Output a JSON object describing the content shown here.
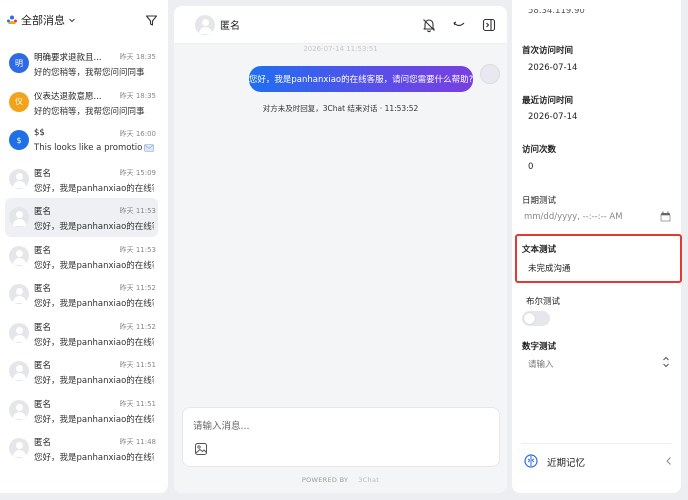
{
  "sidebar": {
    "filter_label": "全部消息",
    "conversations": [
      {
        "name": "明确要求退款且...",
        "time": "昨天 18:35",
        "preview": "好的您稍等，我帮您问问同事",
        "avatar_text": "明",
        "avatar_color": "#2d6ae3"
      },
      {
        "name": "仪表达退款意愿...",
        "time": "昨天 18:35",
        "preview": "好的您稍等，我帮您问问同事",
        "avatar_text": "仪",
        "avatar_color": "#f2a21b"
      },
      {
        "name": "$$",
        "time": "昨天 16:00",
        "preview": "This looks like a promotiona...",
        "avatar_text": "$",
        "avatar_color": "#1f6fe5"
      },
      {
        "name": "匿名",
        "time": "昨天 15:09",
        "preview": "您好，我是panhanxiao的在线客..."
      },
      {
        "name": "匿名",
        "time": "昨天 11:53",
        "preview": "您好，我是panhanxiao的在线客..."
      },
      {
        "name": "匿名",
        "time": "昨天 11:53",
        "preview": "您好，我是panhanxiao的在线客..."
      },
      {
        "name": "匿名",
        "time": "昨天 11:52",
        "preview": "您好，我是panhanxiao的在线客..."
      },
      {
        "name": "匿名",
        "time": "昨天 11:52",
        "preview": "您好，我是panhanxiao的在线客..."
      },
      {
        "name": "匿名",
        "time": "昨天 11:51",
        "preview": "您好，我是panhanxiao的在线客..."
      },
      {
        "name": "匿名",
        "time": "昨天 11:51",
        "preview": "您好，我是panhanxiao的在线客..."
      },
      {
        "name": "匿名",
        "time": "昨天 11:48",
        "preview": "您好，我是panhanxiao的在线客..."
      }
    ]
  },
  "chat": {
    "contact_name": "匿名",
    "timestamp_faded": "2026-07-14 11:53:51",
    "message": "您好，我是panhanxiao的在线客服，请问您需要什么帮助?",
    "system_note": "对方未及时回复，3Chat 结束对话 · 11:53:52",
    "input_placeholder": "请输入消息...",
    "powered_by": "POWERED BY",
    "powered_brand": "3Chat"
  },
  "details": {
    "ip_partial": "58.34.119.90",
    "first_visit_label": "首次访问时间",
    "first_visit_value": "2026-07-14",
    "last_visit_label": "最近访问时间",
    "last_visit_value": "2026-07-14",
    "visit_count_label": "访问次数",
    "visit_count_value": "0",
    "date_test_label": "日期测试",
    "date_test_placeholder": "mm/dd/yyyy, --:--:-- AM",
    "text_test_label": "文本测试",
    "text_test_value": "未完成沟通",
    "bool_test_label": "布尔测试",
    "bool_test_value": false,
    "number_test_label": "数字测试",
    "number_test_placeholder": "请输入",
    "memory_label": "近期记忆"
  },
  "colors": {
    "highlight": "#e03a36",
    "bubble_start": "#1f6ff0",
    "bubble_end": "#7a3fe0"
  }
}
